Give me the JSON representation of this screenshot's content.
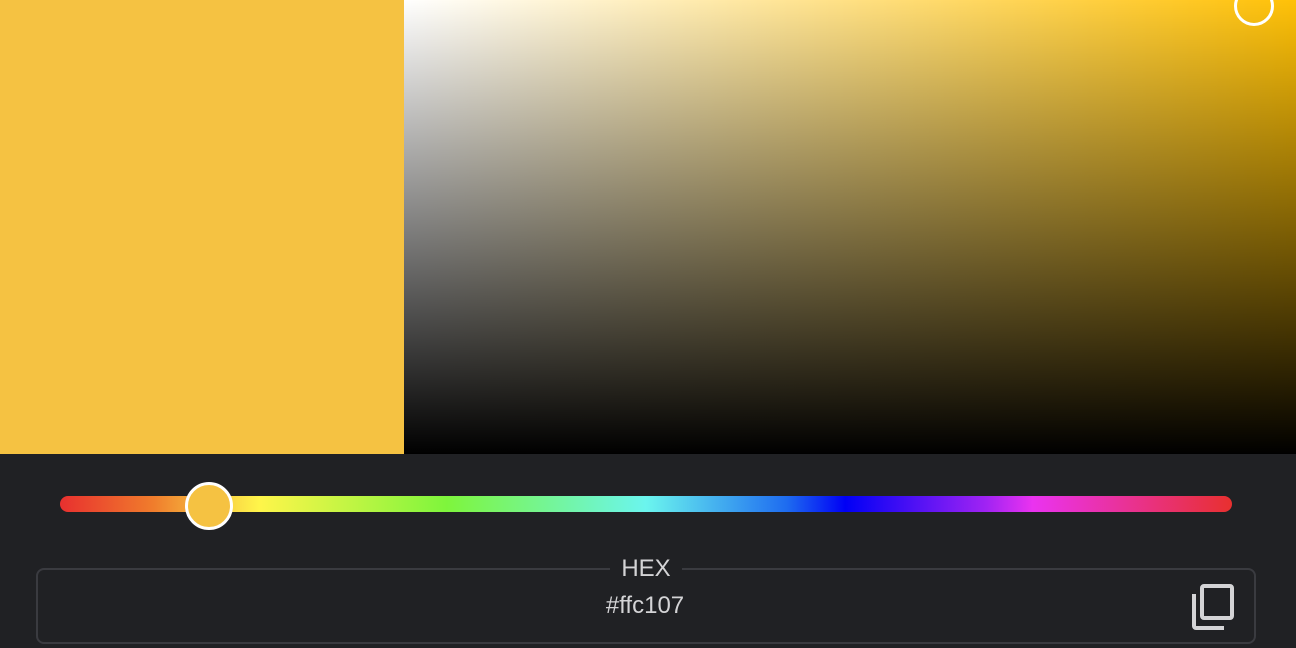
{
  "color": {
    "hex_label": "HEX",
    "hex_value": "#ffc107",
    "swatch_color": "#f5c242",
    "hue_color": "#ffc107"
  },
  "hue": {
    "level_percent": 12.7
  },
  "icons": {
    "copy": "copy-icon"
  }
}
